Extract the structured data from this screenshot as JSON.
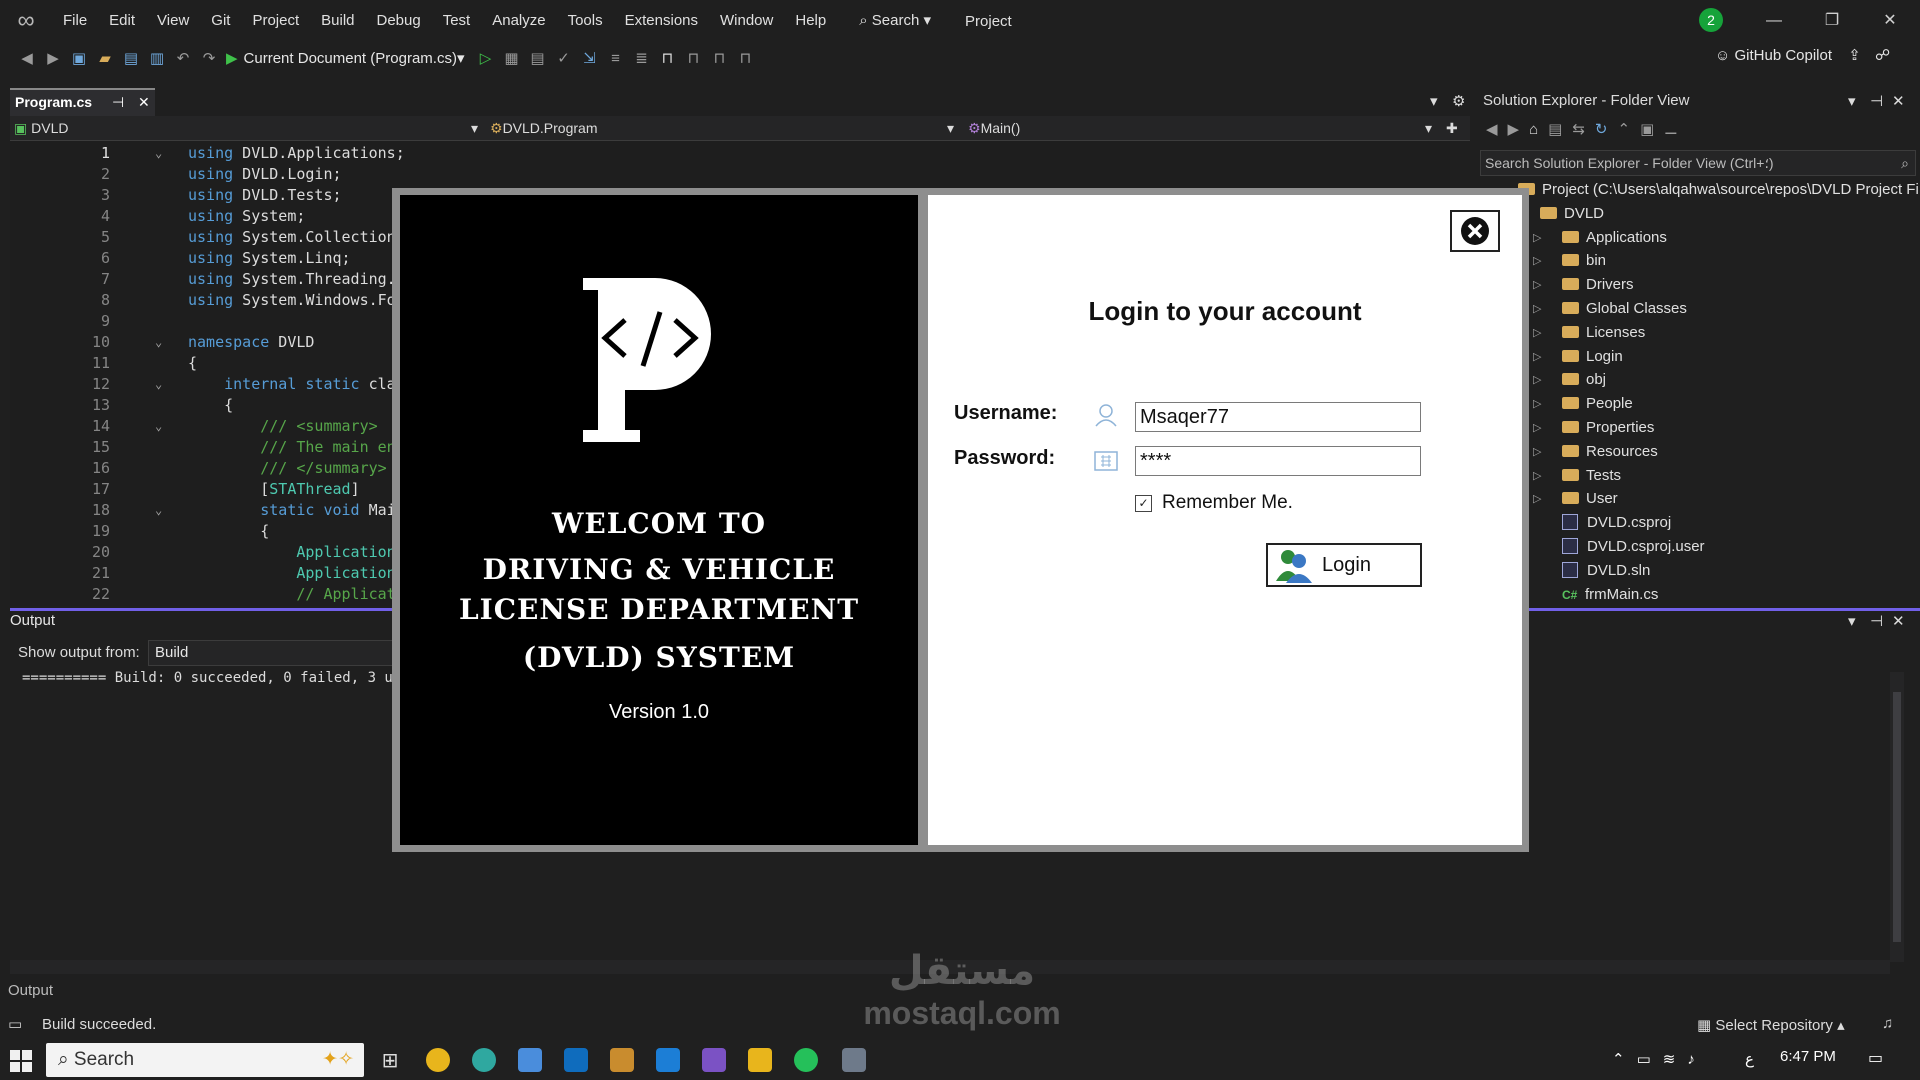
{
  "titlebar": {
    "menu": [
      "File",
      "Edit",
      "View",
      "Git",
      "Project",
      "Build",
      "Debug",
      "Test",
      "Analyze",
      "Tools",
      "Extensions",
      "Window",
      "Help"
    ],
    "search_label": "Search",
    "project_label": "Project",
    "badge_count": "2"
  },
  "toolbar": {
    "run_target": "Current Document (Program.cs)",
    "copilot_label": "GitHub Copilot"
  },
  "editor": {
    "tab_title": "Program.cs",
    "nav_project": "DVLD",
    "nav_class": "DVLD.Program",
    "nav_member": "Main()",
    "lines": [
      {
        "n": "1",
        "text": "using DVLD.Applications;"
      },
      {
        "n": "2",
        "text": "using DVLD.Login;"
      },
      {
        "n": "3",
        "text": "using DVLD.Tests;"
      },
      {
        "n": "4",
        "text": "using System;"
      },
      {
        "n": "5",
        "text": "using System.Collection"
      },
      {
        "n": "6",
        "text": "using System.Linq;"
      },
      {
        "n": "7",
        "text": "using System.Threading."
      },
      {
        "n": "8",
        "text": "using System.Windows.Fo"
      },
      {
        "n": "9",
        "text": ""
      },
      {
        "n": "10",
        "text": "namespace DVLD"
      },
      {
        "n": "11",
        "text": "{"
      },
      {
        "n": "12",
        "text": "    internal static cla"
      },
      {
        "n": "13",
        "text": "    {"
      },
      {
        "n": "14",
        "text": "        /// <summary>"
      },
      {
        "n": "15",
        "text": "        /// The main en"
      },
      {
        "n": "16",
        "text": "        /// </summary>"
      },
      {
        "n": "17",
        "text": "        [STAThread]"
      },
      {
        "n": "18",
        "text": "        static void Mai"
      },
      {
        "n": "19",
        "text": "        {"
      },
      {
        "n": "20",
        "text": "            Application"
      },
      {
        "n": "21",
        "text": "            Application"
      },
      {
        "n": "22",
        "text": "            // Applicat"
      }
    ]
  },
  "solution_explorer": {
    "title": "Solution Explorer - Folder View",
    "search_placeholder": "Search Solution Explorer - Folder View (Ctrl+؛)",
    "root": "Project (C:\\Users\\alqahwa\\source\\repos\\DVLD Project Fi",
    "project_folder": "DVLD",
    "folders": [
      "Applications",
      "bin",
      "Drivers",
      "Global Classes",
      "Licenses",
      "Login",
      "obj",
      "People",
      "Properties",
      "Resources",
      "Tests",
      "User"
    ],
    "files": [
      "DVLD.csproj",
      "DVLD.csproj.user",
      "DVLD.sln",
      "frmMain.cs"
    ]
  },
  "output": {
    "header": "Output",
    "show_from_label": "Show output from:",
    "source": "Build",
    "text": "========== Build: 0 succeeded, 0 failed, 3 up-t",
    "bottom_tab": "Output"
  },
  "status": {
    "message": "Build succeeded.",
    "select_repo": "Select Repository"
  },
  "taskbar": {
    "search_label": "Search",
    "time": "6:47 PM",
    "lang": "ع"
  },
  "watermark": {
    "arabic": "مستقل",
    "domain": "mostaql.com"
  },
  "login": {
    "welcome_lines": [
      "WELCOM TO",
      "DRIVING & VEHICLE",
      "LICENSE DEPARTMENT",
      "(DVLD) SYSTEM"
    ],
    "version": "Version 1.0",
    "title": "Login to your account",
    "username_label": "Username:",
    "username_value": "Msaqer77",
    "password_label": "Password:",
    "password_value": "****",
    "remember_label": "Remember Me.",
    "remember_checked": true,
    "login_button": "Login"
  }
}
